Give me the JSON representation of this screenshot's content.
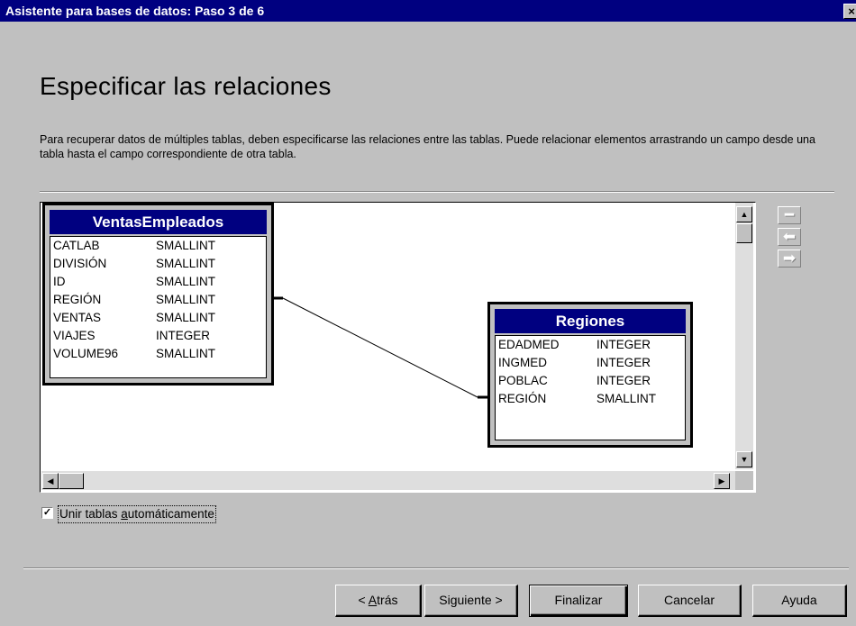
{
  "window": {
    "title": "Asistente para bases de datos: Paso 3 de 6",
    "close_glyph": "×"
  },
  "page": {
    "heading": "Especificar las relaciones",
    "description": "Para recuperar datos de múltiples tablas, deben especificarse las relaciones entre las tablas. Puede relacionar elementos arrastrando un campo desde una tabla hasta el campo correspondiente de otra tabla."
  },
  "tables": [
    {
      "name": "VentasEmpleados",
      "fields": [
        {
          "name": "CATLAB",
          "type": "SMALLINT"
        },
        {
          "name": "DIVISIÓN",
          "type": "SMALLINT"
        },
        {
          "name": "ID",
          "type": "SMALLINT"
        },
        {
          "name": "REGIÓN",
          "type": "SMALLINT"
        },
        {
          "name": "VENTAS",
          "type": "SMALLINT"
        },
        {
          "name": "VIAJES",
          "type": "INTEGER"
        },
        {
          "name": "VOLUME96",
          "type": "SMALLINT"
        }
      ]
    },
    {
      "name": "Regiones",
      "fields": [
        {
          "name": "EDADMED",
          "type": "INTEGER"
        },
        {
          "name": "INGMED",
          "type": "INTEGER"
        },
        {
          "name": "POBLAC",
          "type": "INTEGER"
        },
        {
          "name": "REGIÓN",
          "type": "SMALLINT"
        }
      ]
    }
  ],
  "relationship": {
    "from_table": "VentasEmpleados",
    "to_table": "Regiones",
    "field": "REGIÓN"
  },
  "side_tools": [
    {
      "icon": "minus-icon"
    },
    {
      "icon": "arrow-left-icon"
    },
    {
      "icon": "arrow-right-icon"
    }
  ],
  "auto_join": {
    "checked": true,
    "label_before": "Unir tablas ",
    "label_accel": "a",
    "label_after": "utomáticamente"
  },
  "buttons": {
    "back_prefix": "< ",
    "back_accel": "A",
    "back_rest": "trás",
    "next": "Siguiente >",
    "finish": "Finalizar",
    "cancel": "Cancelar",
    "help": "Ayuda"
  }
}
